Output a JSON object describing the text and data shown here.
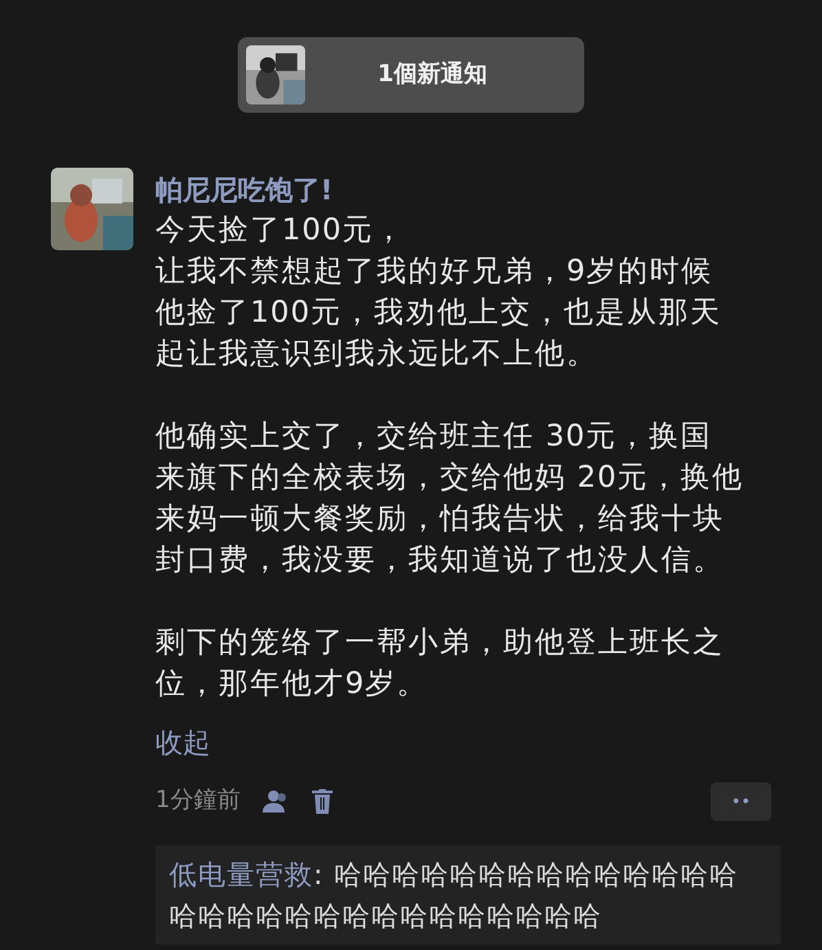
{
  "notification": {
    "text": "1個新通知",
    "kind": "picture"
  },
  "post": {
    "author": "帕尼尼吃饱了!",
    "paragraphs": [
      [
        "今天捡了100元，",
        "让我不禁想起了我的好兄弟，9岁的时候",
        "他捡了100元，我劝他上交，也是从那天",
        "起让我意识到我永远比不上他。"
      ],
      [
        "他确实上交了，交给班主任 30元，换国",
        "来旗下的全校表场，交给他妈 20元，换他",
        "来妈一顿大餐奖励，怕我告状，给我十块",
        "封口费，我没要，我知道说了也没人信。"
      ],
      [
        "剩下的笼络了一帮小弟，助他登上班长之",
        "位，那年他才9岁。"
      ]
    ],
    "collapse": "收起",
    "time": "1分鐘前",
    "more": "••"
  },
  "comments": [
    {
      "author": "低电量营救",
      "separator": ":",
      "text": "哈哈哈哈哈哈哈哈哈哈哈哈哈哈哈哈哈哈哈哈哈哈哈哈哈哈哈哈哈"
    }
  ]
}
